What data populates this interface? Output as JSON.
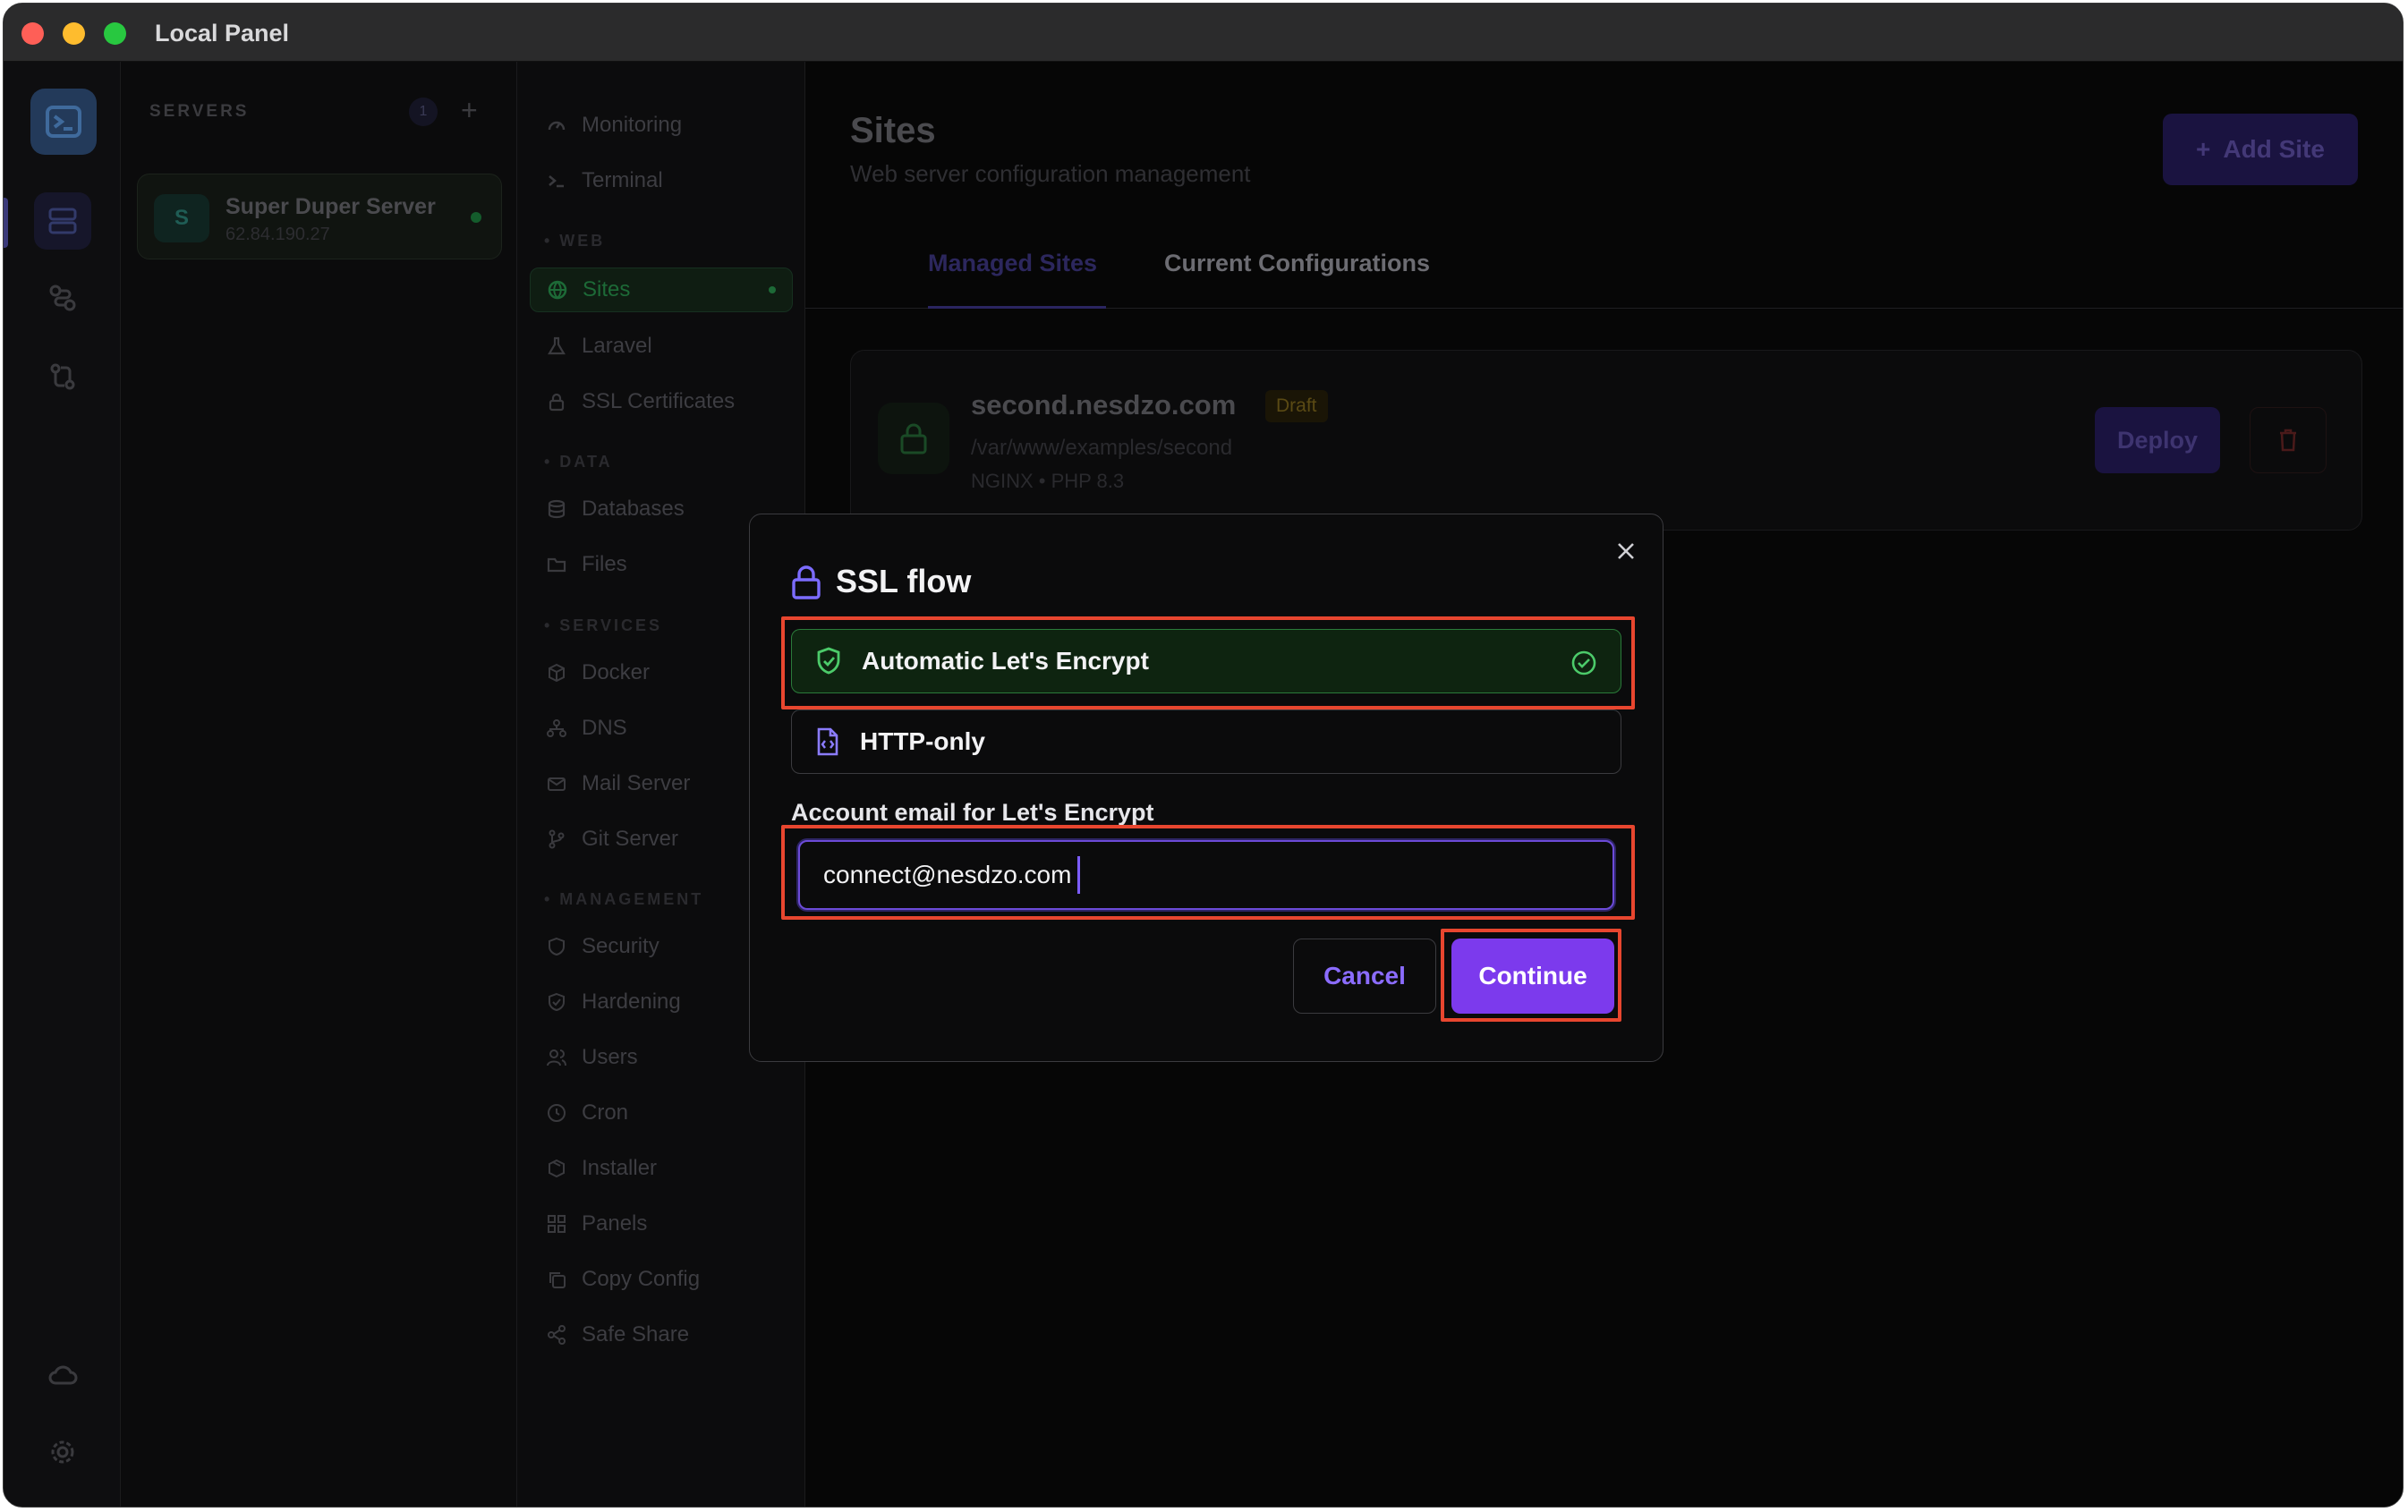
{
  "window": {
    "title": "Local Panel"
  },
  "servers": {
    "title": "SERVERS",
    "count": "1",
    "items": [
      {
        "initial": "S",
        "name": "Super Duper Server",
        "ip": "62.84.190.27"
      }
    ]
  },
  "nav": {
    "items": [
      {
        "label": "Monitoring",
        "icon": "gauge-icon"
      },
      {
        "label": "Terminal",
        "icon": "terminal-icon"
      }
    ],
    "sections": [
      {
        "title": "• WEB",
        "items": [
          "Sites",
          "Laravel",
          "SSL Certificates"
        ]
      },
      {
        "title": "• DATA",
        "items": [
          "Databases",
          "Files"
        ]
      },
      {
        "title": "• SERVICES",
        "items": [
          "Docker",
          "DNS",
          "Mail Server",
          "Git Server"
        ]
      },
      {
        "title": "• MANAGEMENT",
        "items": [
          "Security",
          "Hardening",
          "Users",
          "Cron",
          "Installer",
          "Panels",
          "Copy Config",
          "Safe Share"
        ]
      }
    ]
  },
  "main": {
    "title": "Sites",
    "subtitle": "Web server configuration management",
    "add_site_label": "Add Site",
    "tabs": [
      "Managed Sites",
      "Current Configurations"
    ],
    "site": {
      "name": "second.nesdzo.com",
      "badge": "Draft",
      "path": "/var/www/examples/second",
      "meta": "NGINX • PHP 8.3",
      "deploy_label": "Deploy"
    }
  },
  "dialog": {
    "title": "SSL flow",
    "options": [
      {
        "label": "Automatic Let's Encrypt",
        "selected": true
      },
      {
        "label": "HTTP-only",
        "selected": false
      }
    ],
    "email_label": "Account email for Let's Encrypt",
    "email_value": "connect@nesdzo.com",
    "cancel_label": "Cancel",
    "continue_label": "Continue"
  },
  "colors": {
    "accent": "#7c3aed",
    "success": "#2a7a3a",
    "highlight": "#e8462f"
  }
}
